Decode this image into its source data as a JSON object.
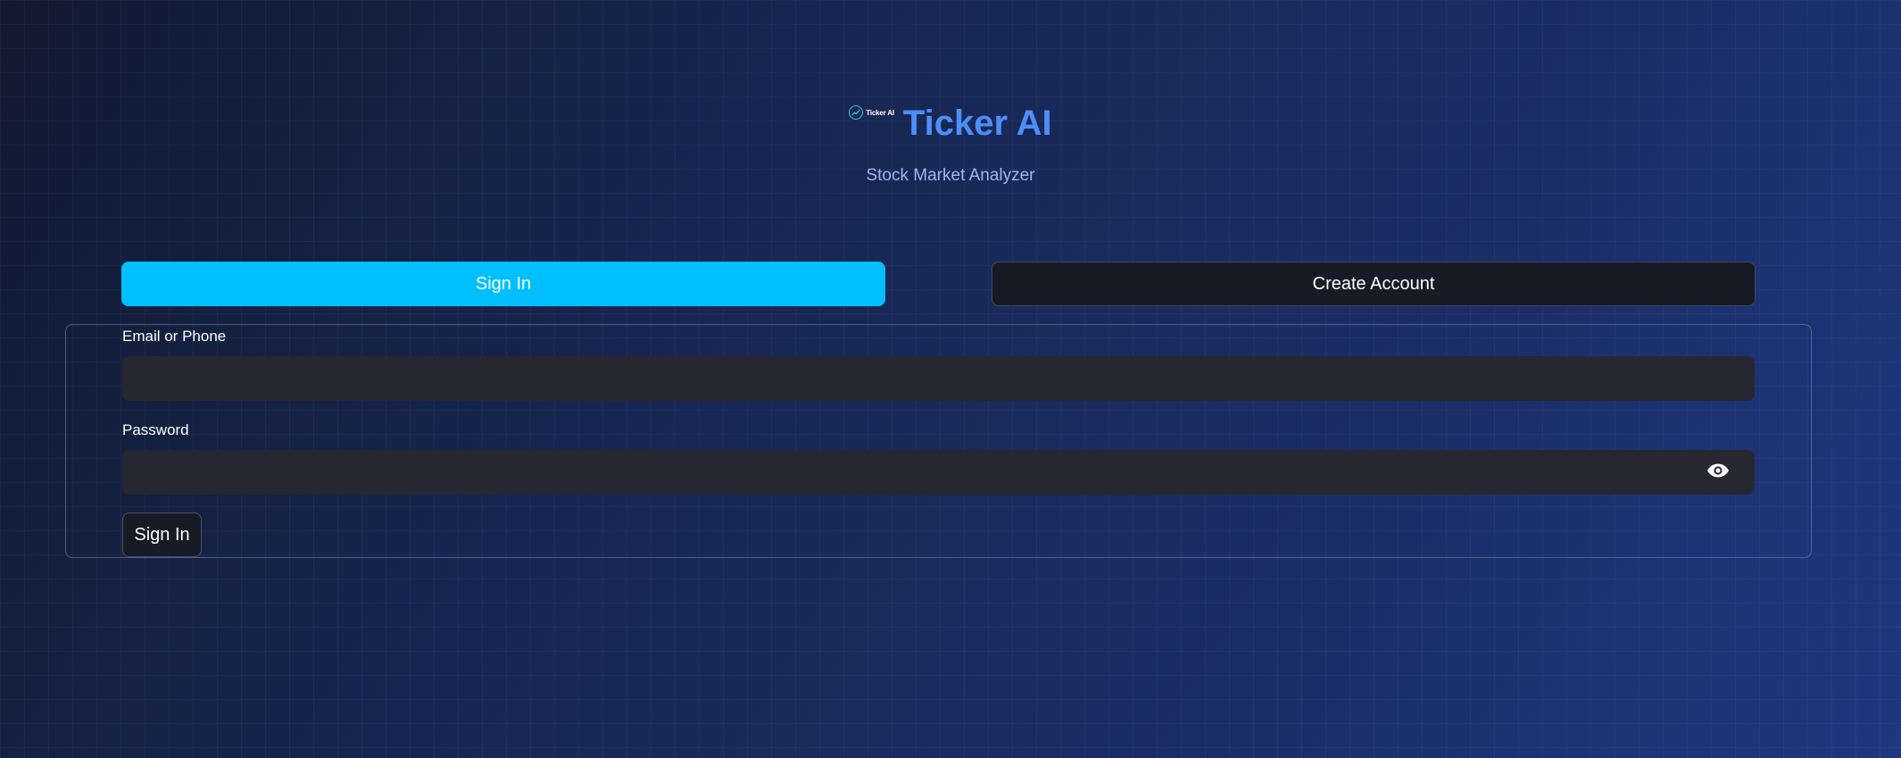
{
  "app": {
    "logo_text": "Ticker AI",
    "title": "Ticker AI",
    "subtitle": "Stock Market Analyzer"
  },
  "tabs": [
    {
      "label": "Sign In",
      "active": true
    },
    {
      "label": "Create Account",
      "active": false
    }
  ],
  "form": {
    "email_label": "Email or Phone",
    "email_value": "",
    "password_label": "Password",
    "password_value": "",
    "submit_label": "Sign In"
  },
  "icons": {
    "logo": "trend-line-icon",
    "password_toggle": "eye-icon"
  },
  "colors": {
    "accent": "#00bfff",
    "title": "#4d8ef7",
    "subtitle": "#a3b4ee",
    "input_bg": "#262731",
    "button_dark": "#161b26"
  }
}
